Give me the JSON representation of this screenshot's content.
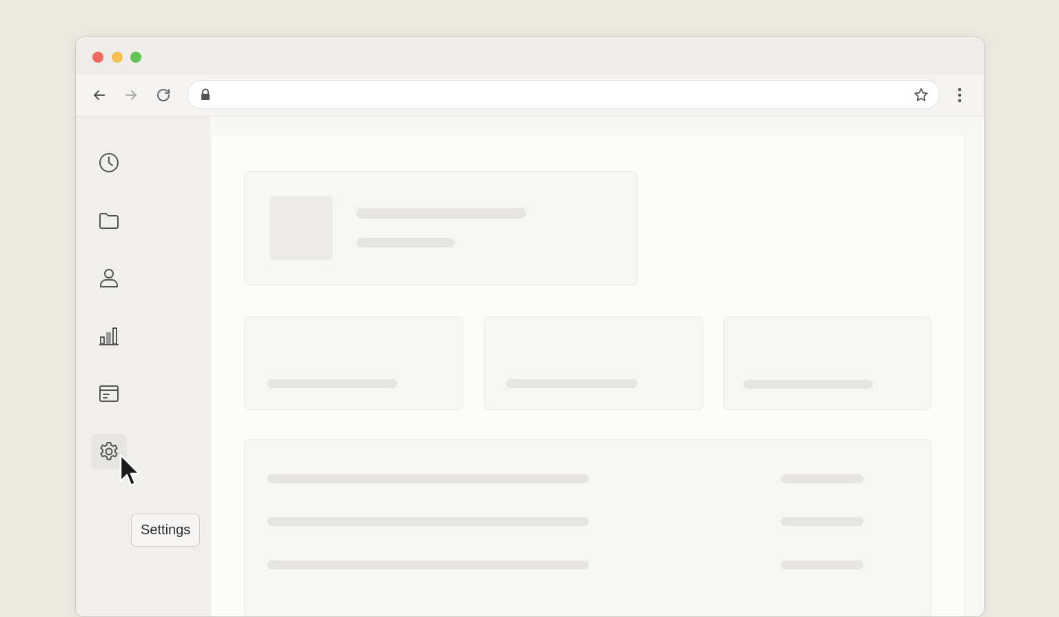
{
  "window": {
    "controls": [
      "close",
      "minimize",
      "maximize"
    ],
    "control_colors": {
      "close": "#ed6a5e",
      "minimize": "#f4bf4f",
      "maximize": "#61c454"
    }
  },
  "toolbar": {
    "back_icon": "arrow-left-icon",
    "forward_icon": "arrow-right-icon",
    "reload_icon": "reload-icon",
    "address_value": "",
    "secure_icon": "lock-icon",
    "bookmark_icon": "star-icon",
    "menu_icon": "kebab-menu-icon"
  },
  "sidebar": {
    "items": [
      {
        "id": "recent",
        "icon": "clock-icon"
      },
      {
        "id": "files",
        "icon": "folder-icon"
      },
      {
        "id": "profile",
        "icon": "user-icon"
      },
      {
        "id": "analytics",
        "icon": "bar-chart-icon"
      },
      {
        "id": "billing",
        "icon": "card-icon"
      },
      {
        "id": "settings",
        "icon": "gear-icon",
        "active": true
      }
    ]
  },
  "tooltip": {
    "label": "Settings"
  },
  "main": {
    "state": "loading-skeleton",
    "stat_cards": 3,
    "list_rows": 3
  },
  "colors": {
    "background": "#ebe8e0",
    "skeleton": "#e6e5e2",
    "icon": "#555555"
  }
}
